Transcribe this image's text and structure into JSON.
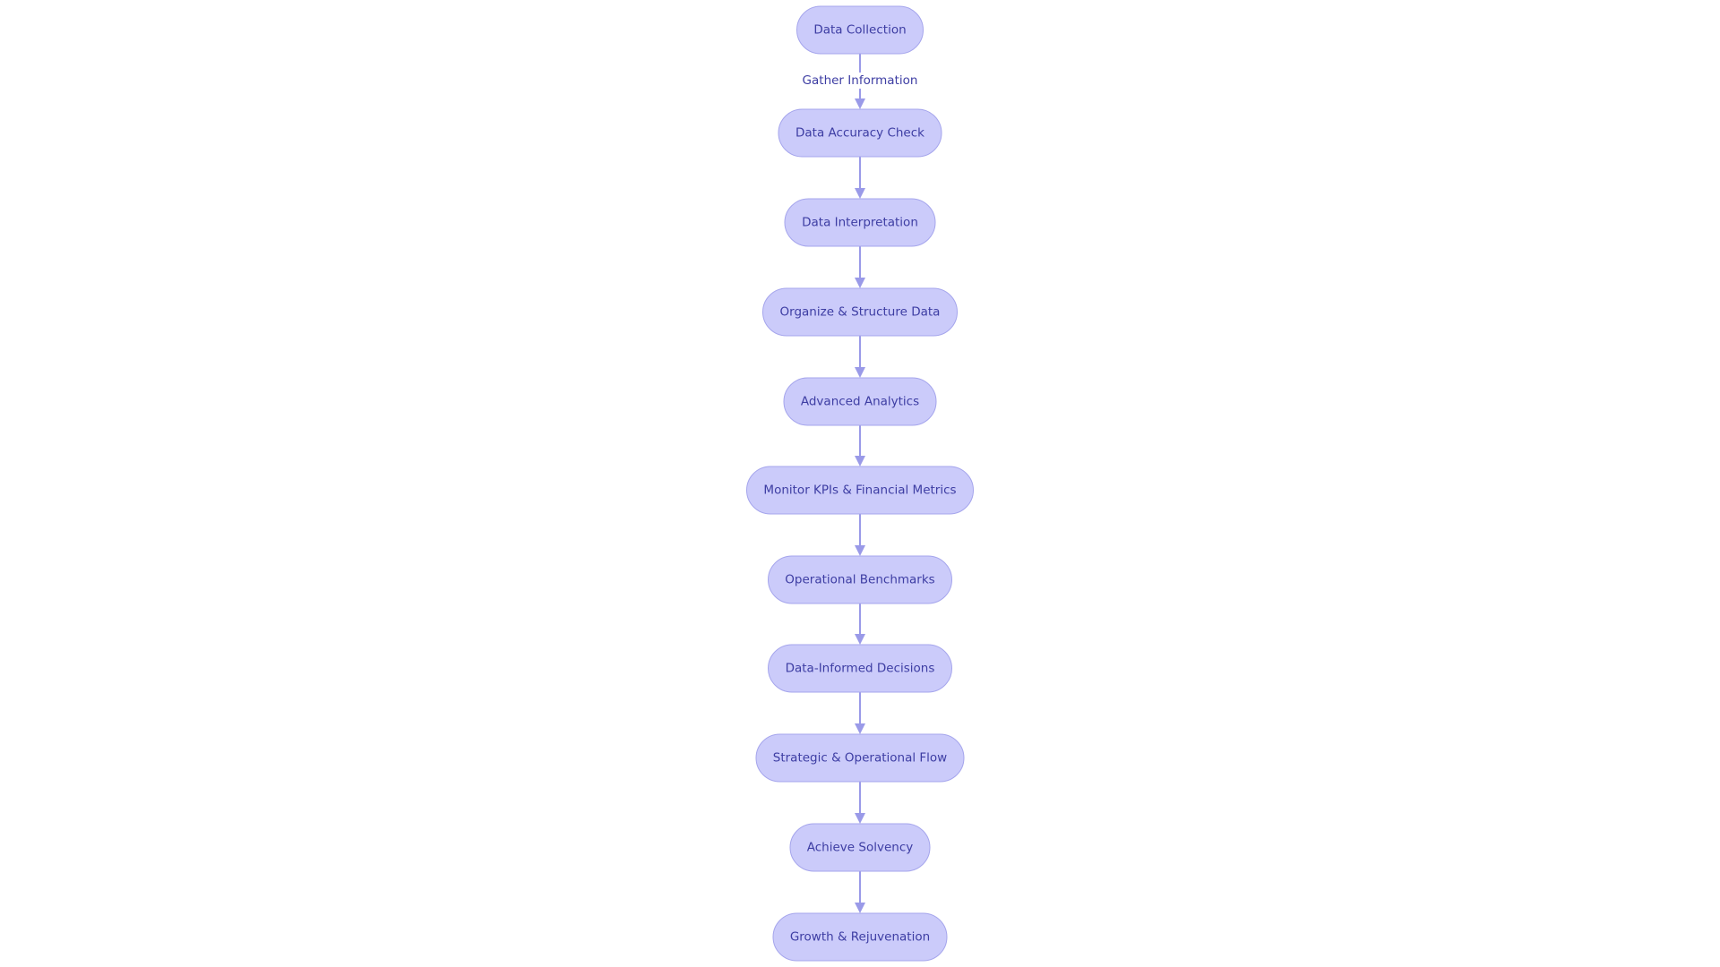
{
  "diagram": {
    "type": "flowchart",
    "direction": "top-to-bottom",
    "colors": {
      "node_fill": "#cbcbfa",
      "node_stroke": "#a5a5ec",
      "text": "#3d3da3",
      "edge": "#9a9ae8",
      "background": "#ffffff"
    },
    "nodes": [
      {
        "id": "n1",
        "label": "Data Collection"
      },
      {
        "id": "n2",
        "label": "Data Accuracy Check"
      },
      {
        "id": "n3",
        "label": "Data Interpretation"
      },
      {
        "id": "n4",
        "label": "Organize & Structure Data"
      },
      {
        "id": "n5",
        "label": "Advanced Analytics"
      },
      {
        "id": "n6",
        "label": "Monitor KPIs & Financial Metrics"
      },
      {
        "id": "n7",
        "label": "Operational Benchmarks"
      },
      {
        "id": "n8",
        "label": "Data-Informed Decisions"
      },
      {
        "id": "n9",
        "label": "Strategic & Operational Flow"
      },
      {
        "id": "n10",
        "label": "Achieve Solvency"
      },
      {
        "id": "n11",
        "label": "Growth & Rejuvenation"
      }
    ],
    "edges": [
      {
        "from": "n1",
        "to": "n2",
        "label": "Gather Information"
      },
      {
        "from": "n2",
        "to": "n3",
        "label": ""
      },
      {
        "from": "n3",
        "to": "n4",
        "label": ""
      },
      {
        "from": "n4",
        "to": "n5",
        "label": ""
      },
      {
        "from": "n5",
        "to": "n6",
        "label": ""
      },
      {
        "from": "n6",
        "to": "n7",
        "label": ""
      },
      {
        "from": "n7",
        "to": "n8",
        "label": ""
      },
      {
        "from": "n8",
        "to": "n9",
        "label": ""
      },
      {
        "from": "n9",
        "to": "n10",
        "label": ""
      },
      {
        "from": "n10",
        "to": "n11",
        "label": ""
      }
    ]
  }
}
